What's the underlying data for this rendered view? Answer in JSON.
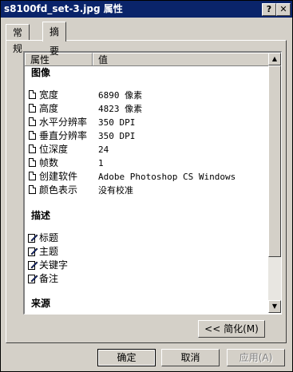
{
  "window": {
    "title": "s8100fd_set-3.jpg 属性",
    "help_glyph": "?",
    "close_glyph": "✕"
  },
  "tabs": [
    {
      "label": "常规"
    },
    {
      "label": "摘要"
    }
  ],
  "list": {
    "columns": [
      "属性",
      "值"
    ],
    "groups": {
      "image": "图像",
      "description": "描述",
      "origin": "来源"
    },
    "image_props": [
      {
        "name": "宽度",
        "value": "6890 像素"
      },
      {
        "name": "高度",
        "value": "4823 像素"
      },
      {
        "name": "水平分辨率",
        "value": "350 DPI"
      },
      {
        "name": "垂直分辨率",
        "value": "350 DPI"
      },
      {
        "name": "位深度",
        "value": "24"
      },
      {
        "name": "帧数",
        "value": "1"
      },
      {
        "name": "创建软件",
        "value": "Adobe Photoshop CS Windows"
      },
      {
        "name": "颜色表示",
        "value": "没有校准"
      }
    ],
    "desc_props": [
      {
        "name": "标题",
        "value": ""
      },
      {
        "name": "主题",
        "value": ""
      },
      {
        "name": "关键字",
        "value": ""
      },
      {
        "name": "备注",
        "value": ""
      }
    ],
    "scroll_up": "▲",
    "scroll_down": "▼"
  },
  "simple_button": "<< 简化(M)",
  "buttons": {
    "ok": "确定",
    "cancel": "取消",
    "apply": "应用(A)"
  }
}
